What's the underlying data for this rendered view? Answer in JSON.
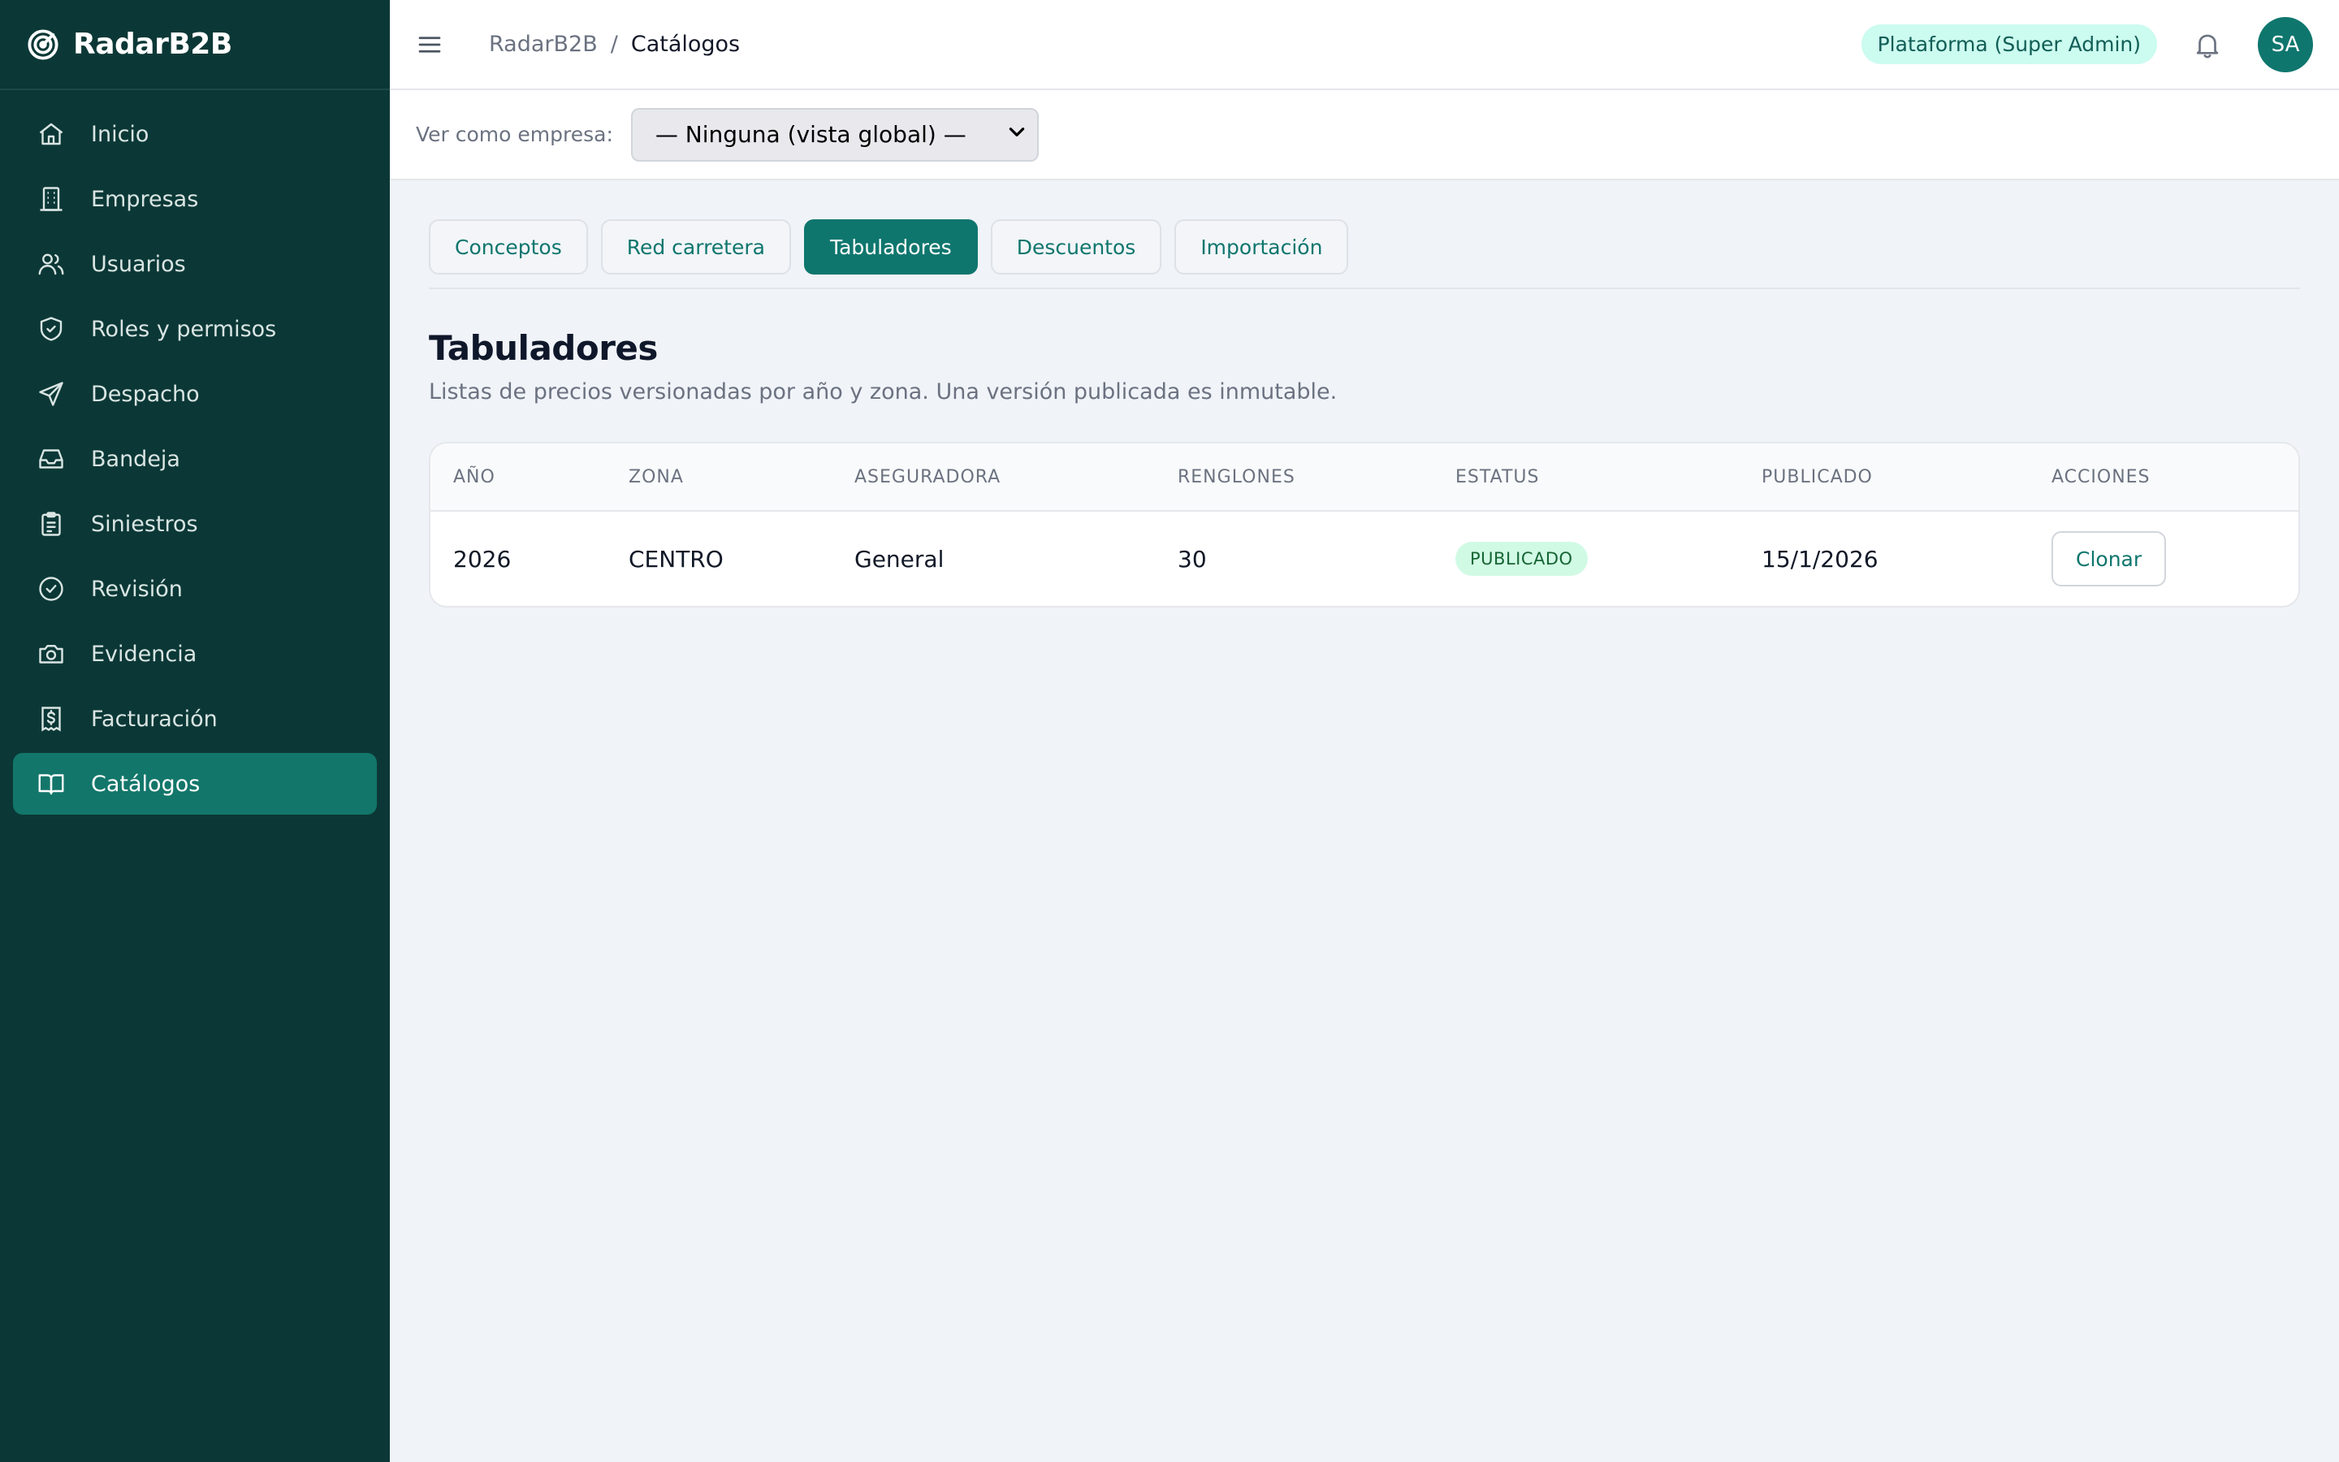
{
  "sidebar": {
    "brand": "RadarB2B",
    "items": [
      {
        "label": "Inicio",
        "icon": "home-icon"
      },
      {
        "label": "Empresas",
        "icon": "building-icon"
      },
      {
        "label": "Usuarios",
        "icon": "users-icon"
      },
      {
        "label": "Roles y permisos",
        "icon": "shield-icon"
      },
      {
        "label": "Despacho",
        "icon": "send-icon"
      },
      {
        "label": "Bandeja",
        "icon": "inbox-icon"
      },
      {
        "label": "Siniestros",
        "icon": "clipboard-icon"
      },
      {
        "label": "Revisión",
        "icon": "check-circle-icon"
      },
      {
        "label": "Evidencia",
        "icon": "camera-icon"
      },
      {
        "label": "Facturación",
        "icon": "receipt-icon"
      },
      {
        "label": "Catálogos",
        "icon": "book-icon",
        "active": true
      }
    ]
  },
  "header": {
    "breadcrumb_root": "RadarB2B",
    "breadcrumb_sep": "/",
    "breadcrumb_current": "Catálogos",
    "role_badge": "Plataforma (Super Admin)",
    "avatar_initials": "SA"
  },
  "company_filter": {
    "label": "Ver como empresa:",
    "selected": "— Ninguna (vista global) —"
  },
  "tabs": [
    {
      "label": "Conceptos"
    },
    {
      "label": "Red carretera"
    },
    {
      "label": "Tabuladores",
      "active": true
    },
    {
      "label": "Descuentos"
    },
    {
      "label": "Importación"
    }
  ],
  "page": {
    "title": "Tabuladores",
    "subtitle": "Listas de precios versionadas por año y zona. Una versión publicada es inmutable."
  },
  "table": {
    "columns": [
      "AÑO",
      "ZONA",
      "ASEGURADORA",
      "RENGLONES",
      "ESTATUS",
      "PUBLICADO",
      "ACCIONES"
    ],
    "rows": [
      {
        "year": "2026",
        "zone": "CENTRO",
        "insurer": "General",
        "rows": "30",
        "status": "PUBLICADO",
        "published": "15/1/2026",
        "action": "Clonar"
      }
    ]
  },
  "colors": {
    "sidebar_bg": "#0b3836",
    "accent": "#0f766e",
    "active_nav": "#13766a",
    "page_bg": "#f0f3f8",
    "status_badge_bg": "#d1fae5"
  }
}
